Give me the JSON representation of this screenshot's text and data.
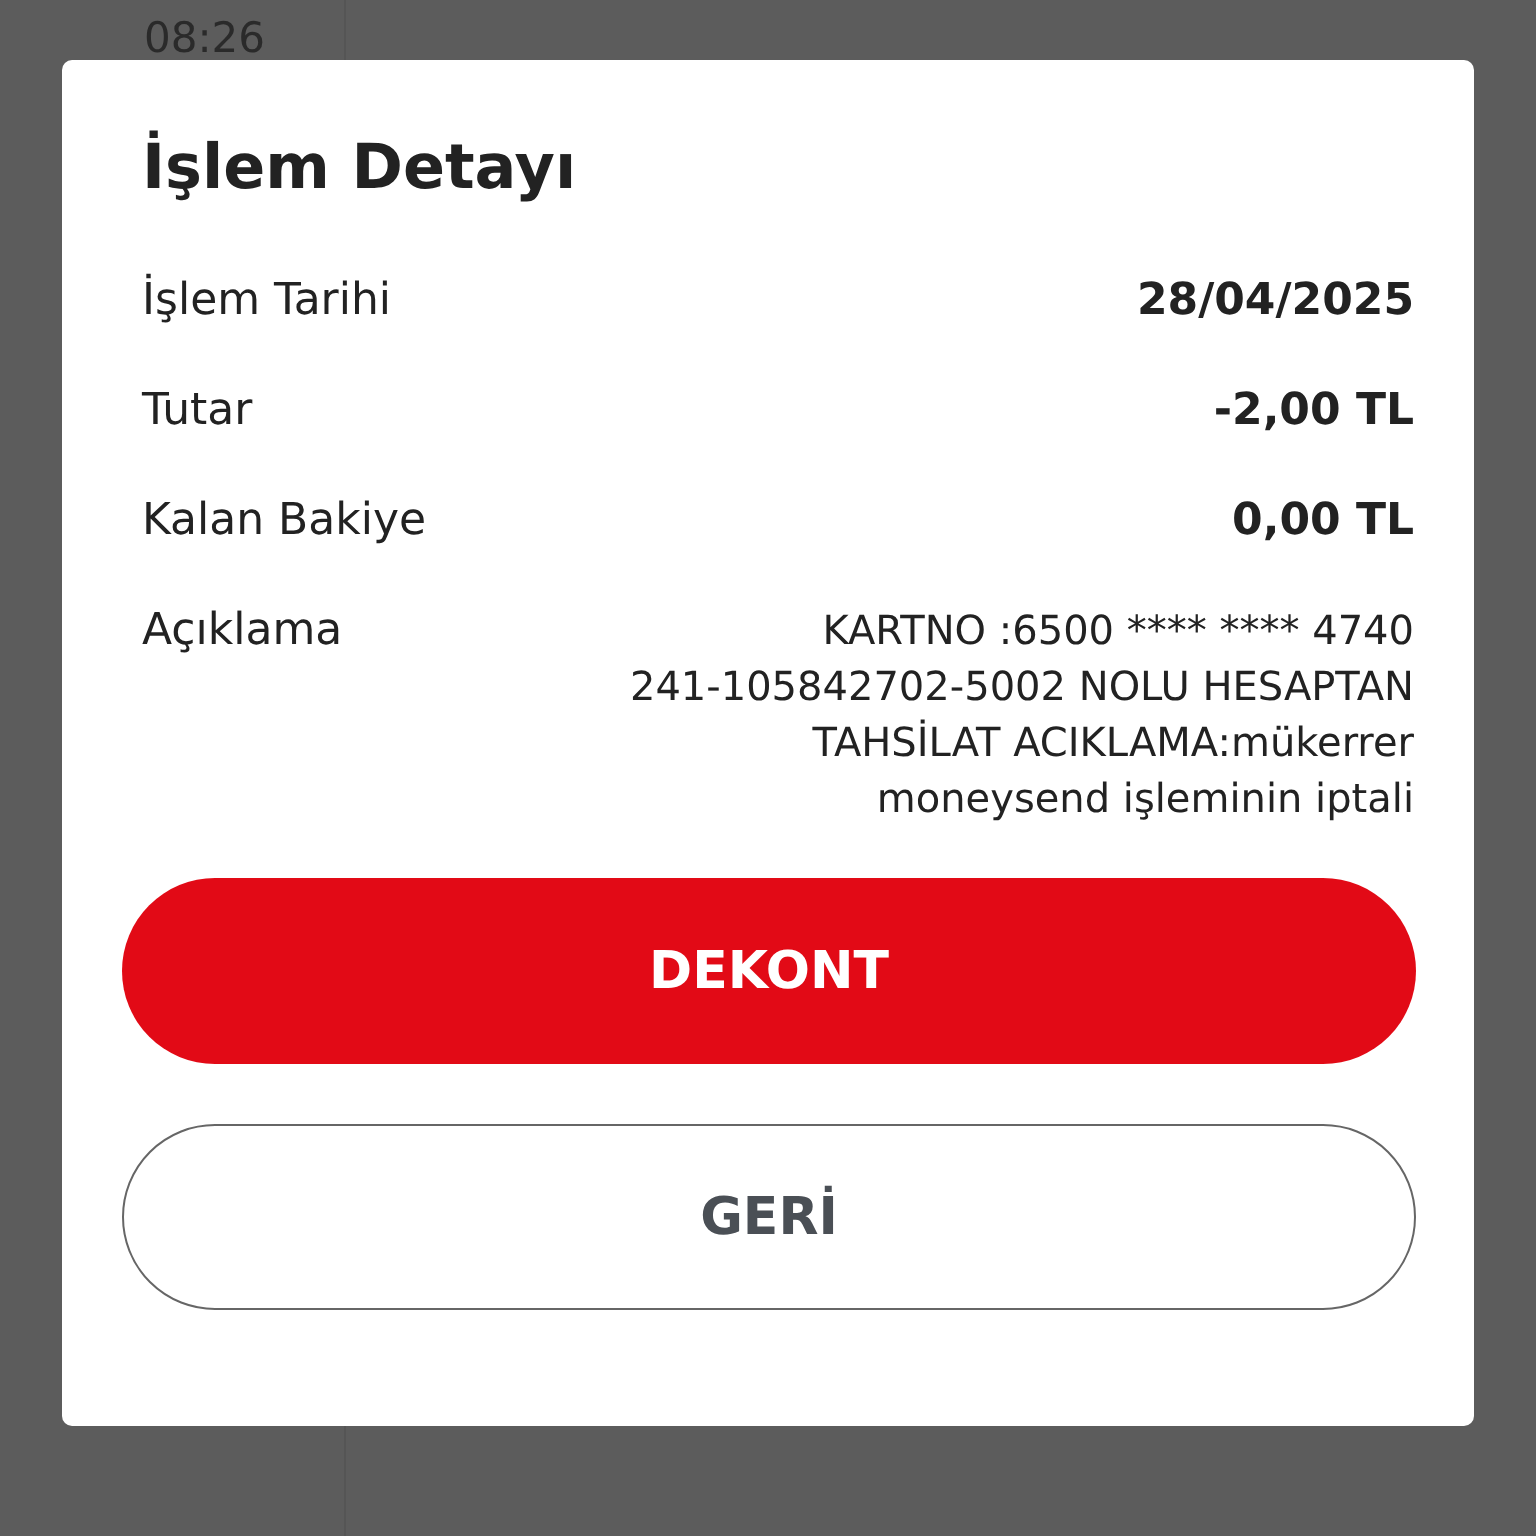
{
  "background": {
    "time": "08:26"
  },
  "dialog": {
    "title": "İşlem Detayı",
    "rows": [
      {
        "label": "İşlem Tarihi",
        "value": "28/04/2025",
        "kind": "strong"
      },
      {
        "label": "Tutar",
        "value": "-2,00 TL",
        "kind": "strong"
      },
      {
        "label": "Kalan Bakiye",
        "value": "0,00 TL",
        "kind": "strong"
      },
      {
        "label": "Açıklama",
        "value": "KARTNO :6500 **** **** 4740\n241-105842702-5002 NOLU HESAPTAN\nTAHSİLAT ACIKLAMA:mükerrer\nmoneysend işleminin iptali",
        "kind": "plain"
      }
    ],
    "buttons": [
      {
        "label": "DEKONT",
        "kind": "primary"
      },
      {
        "label": "GERİ",
        "kind": "outline"
      }
    ]
  }
}
